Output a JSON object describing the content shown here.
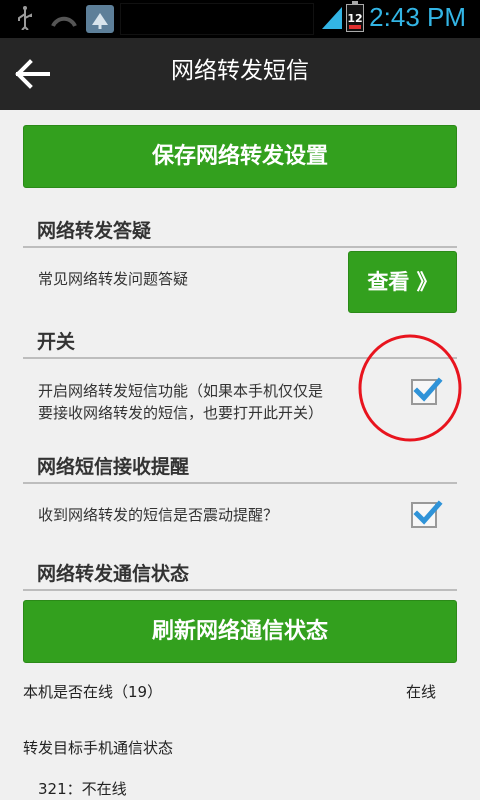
{
  "statusbar": {
    "battery_level": "12",
    "time": "2:43 PM"
  },
  "actionbar": {
    "title": "网络转发短信"
  },
  "buttons": {
    "save": "保存网络转发设置",
    "view": "查看 》",
    "refresh": "刷新网络通信状态"
  },
  "sections": {
    "faq": {
      "header": "网络转发答疑",
      "text": "常见网络转发问题答疑"
    },
    "switch": {
      "header": "开关",
      "text_line1": "开启网络转发短信功能（如果本手机仅仅是",
      "text_line2": "要接收网络转发的短信，也要打开此开关）",
      "checked": true
    },
    "reminder": {
      "header": "网络短信接收提醒",
      "text": "收到网络转发的短信是否震动提醒？",
      "checked": true
    },
    "status": {
      "header": "网络转发通信状态",
      "online_label": "本机是否在线（19）",
      "online_value": "在线",
      "target_label": "转发目标手机通信状态",
      "target_item": "321：不在线"
    }
  },
  "colors": {
    "accent_green": "#33a01e",
    "status_blue": "#33b5e5",
    "annotation_red": "#e8141e"
  }
}
